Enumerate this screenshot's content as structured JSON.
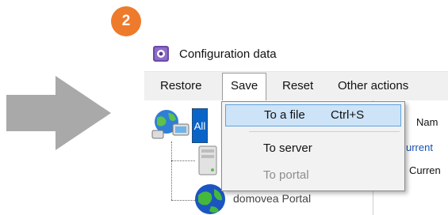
{
  "step": {
    "number": "2"
  },
  "window": {
    "title": "Configuration data"
  },
  "menubar": {
    "items": [
      {
        "label": "Restore"
      },
      {
        "label": "Save"
      },
      {
        "label": "Reset"
      },
      {
        "label": "Other actions"
      }
    ]
  },
  "tree": {
    "root_label": "All",
    "portal_label": "domovea Portal"
  },
  "right_pane": {
    "header_partial": "Nam",
    "row1_partial": "urrent",
    "row2_partial": "Curren"
  },
  "save_menu": {
    "items": [
      {
        "label": "To a file",
        "shortcut": "Ctrl+S",
        "highlighted": true,
        "enabled": true
      },
      {
        "label": "To server",
        "enabled": true
      },
      {
        "label": "To portal",
        "enabled": false
      }
    ]
  },
  "colors": {
    "badge": "#ee7a2c",
    "arrow": "#a9a9a9",
    "highlight_bg": "#cde3f7",
    "highlight_border": "#5ba3e0",
    "selected_tree_item": "#0a64c8",
    "link_blue": "#1a4fb4"
  },
  "icons": {
    "arrow": "right-arrow-icon",
    "app": "configuration-app-icon",
    "network": "network-globe-icon",
    "server": "server-icon",
    "portal": "portal-globe-icon"
  }
}
